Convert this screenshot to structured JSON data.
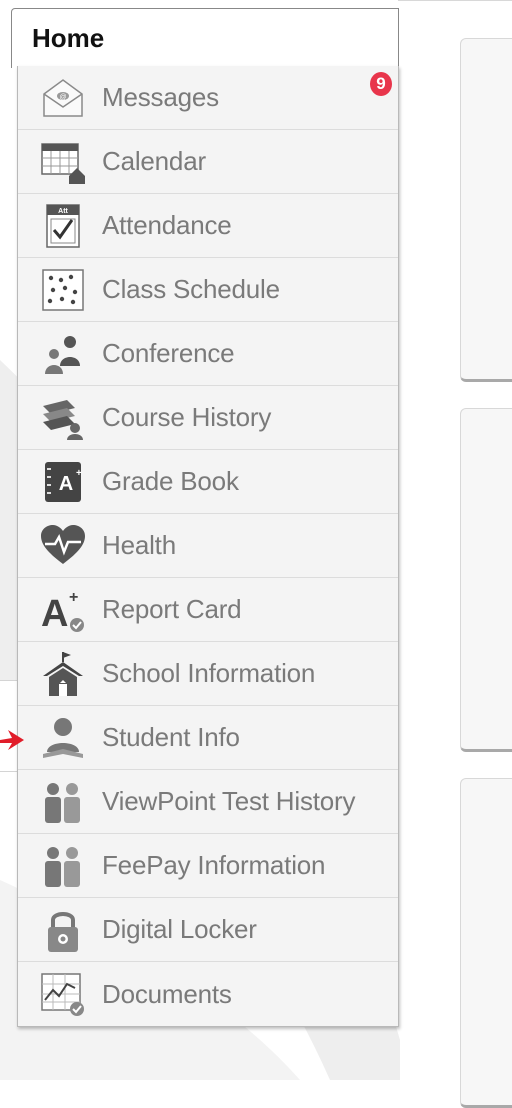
{
  "home_tab": {
    "label": "Home"
  },
  "messages_badge": "9",
  "menu": [
    {
      "id": "messages",
      "label": "Messages",
      "icon": "envelope-icon"
    },
    {
      "id": "calendar",
      "label": "Calendar",
      "icon": "calendar-icon"
    },
    {
      "id": "attendance",
      "label": "Attendance",
      "icon": "attendance-icon"
    },
    {
      "id": "class-schedule",
      "label": "Class Schedule",
      "icon": "schedule-grid-icon"
    },
    {
      "id": "conference",
      "label": "Conference",
      "icon": "conference-people-icon"
    },
    {
      "id": "course-history",
      "label": "Course History",
      "icon": "books-icon"
    },
    {
      "id": "grade-book",
      "label": "Grade Book",
      "icon": "gradebook-icon"
    },
    {
      "id": "health",
      "label": "Health",
      "icon": "heart-pulse-icon"
    },
    {
      "id": "report-card",
      "label": "Report Card",
      "icon": "a-plus-icon"
    },
    {
      "id": "school-information",
      "label": "School Information",
      "icon": "school-house-icon"
    },
    {
      "id": "student-info",
      "label": "Student Info",
      "icon": "student-icon"
    },
    {
      "id": "viewpoint-test-history",
      "label": "ViewPoint Test History",
      "icon": "people-pair-icon"
    },
    {
      "id": "feepay-information",
      "label": "FeePay Information",
      "icon": "people-pair-icon"
    },
    {
      "id": "digital-locker",
      "label": "Digital Locker",
      "icon": "padlock-icon"
    },
    {
      "id": "documents",
      "label": "Documents",
      "icon": "chart-document-icon"
    }
  ],
  "colors": {
    "badge": "#e8354b",
    "arrow": "#e11d2a",
    "icon_gray": "#555555",
    "label_gray": "#7a7a7a"
  }
}
